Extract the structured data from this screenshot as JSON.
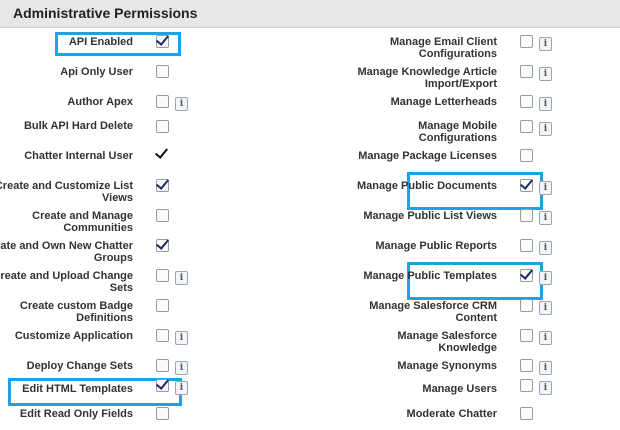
{
  "section_title": "Administrative Permissions",
  "left": [
    {
      "label": "API Enabled",
      "checked": true,
      "info": false,
      "highlight": true,
      "plain": false
    },
    {
      "label": "Api Only User",
      "checked": false,
      "info": false,
      "highlight": false,
      "plain": false
    },
    {
      "label": "Author Apex",
      "checked": false,
      "info": true,
      "highlight": false,
      "plain": false
    },
    {
      "label": "Bulk API Hard Delete",
      "checked": false,
      "info": false,
      "highlight": false,
      "plain": false
    },
    {
      "label": "Chatter Internal User",
      "checked": true,
      "info": false,
      "highlight": false,
      "plain": true
    },
    {
      "label": "Create and Customize List Views",
      "checked": true,
      "info": false,
      "highlight": false,
      "plain": false
    },
    {
      "label": "Create and Manage Communities",
      "checked": false,
      "info": false,
      "highlight": false,
      "plain": false
    },
    {
      "label": "Create and Own New Chatter Groups",
      "checked": true,
      "info": false,
      "highlight": false,
      "plain": false
    },
    {
      "label": "Create and Upload Change Sets",
      "checked": false,
      "info": true,
      "highlight": false,
      "plain": false
    },
    {
      "label": "Create custom Badge Definitions",
      "checked": false,
      "info": false,
      "highlight": false,
      "plain": false
    },
    {
      "label": "Customize Application",
      "checked": false,
      "info": true,
      "highlight": false,
      "plain": false
    },
    {
      "label": "Deploy Change Sets",
      "checked": false,
      "info": true,
      "highlight": false,
      "plain": false
    },
    {
      "label": "Edit HTML Templates",
      "checked": true,
      "info": true,
      "highlight": true,
      "plain": false
    },
    {
      "label": "Edit Read Only Fields",
      "checked": false,
      "info": false,
      "highlight": false,
      "plain": false
    }
  ],
  "right": [
    {
      "label": "Manage Email Client Configurations",
      "checked": false,
      "info": true,
      "highlight": false
    },
    {
      "label": "Manage Knowledge Article Import/Export",
      "checked": false,
      "info": true,
      "highlight": false
    },
    {
      "label": "Manage Letterheads",
      "checked": false,
      "info": true,
      "highlight": false
    },
    {
      "label": "Manage Mobile Configurations",
      "checked": false,
      "info": true,
      "highlight": false
    },
    {
      "label": "Manage Package Licenses",
      "checked": false,
      "info": false,
      "highlight": false
    },
    {
      "label": "Manage Public Documents",
      "checked": true,
      "info": true,
      "highlight": true
    },
    {
      "label": "Manage Public List Views",
      "checked": false,
      "info": true,
      "highlight": false
    },
    {
      "label": "Manage Public Reports",
      "checked": false,
      "info": true,
      "highlight": false
    },
    {
      "label": "Manage Public Templates",
      "checked": true,
      "info": true,
      "highlight": true
    },
    {
      "label": "Manage Salesforce CRM Content",
      "checked": false,
      "info": true,
      "highlight": false
    },
    {
      "label": "Manage Salesforce Knowledge",
      "checked": false,
      "info": true,
      "highlight": false
    },
    {
      "label": "Manage Synonyms",
      "checked": false,
      "info": true,
      "highlight": false
    },
    {
      "label": "Manage Users",
      "checked": false,
      "info": true,
      "highlight": false
    },
    {
      "label": "Moderate Chatter",
      "checked": false,
      "info": false,
      "highlight": false
    }
  ],
  "info_glyph": "i",
  "colors": {
    "highlight": "#1ea3e2",
    "header_bg": "#e7e7e7",
    "check": "#1b2a6b"
  }
}
